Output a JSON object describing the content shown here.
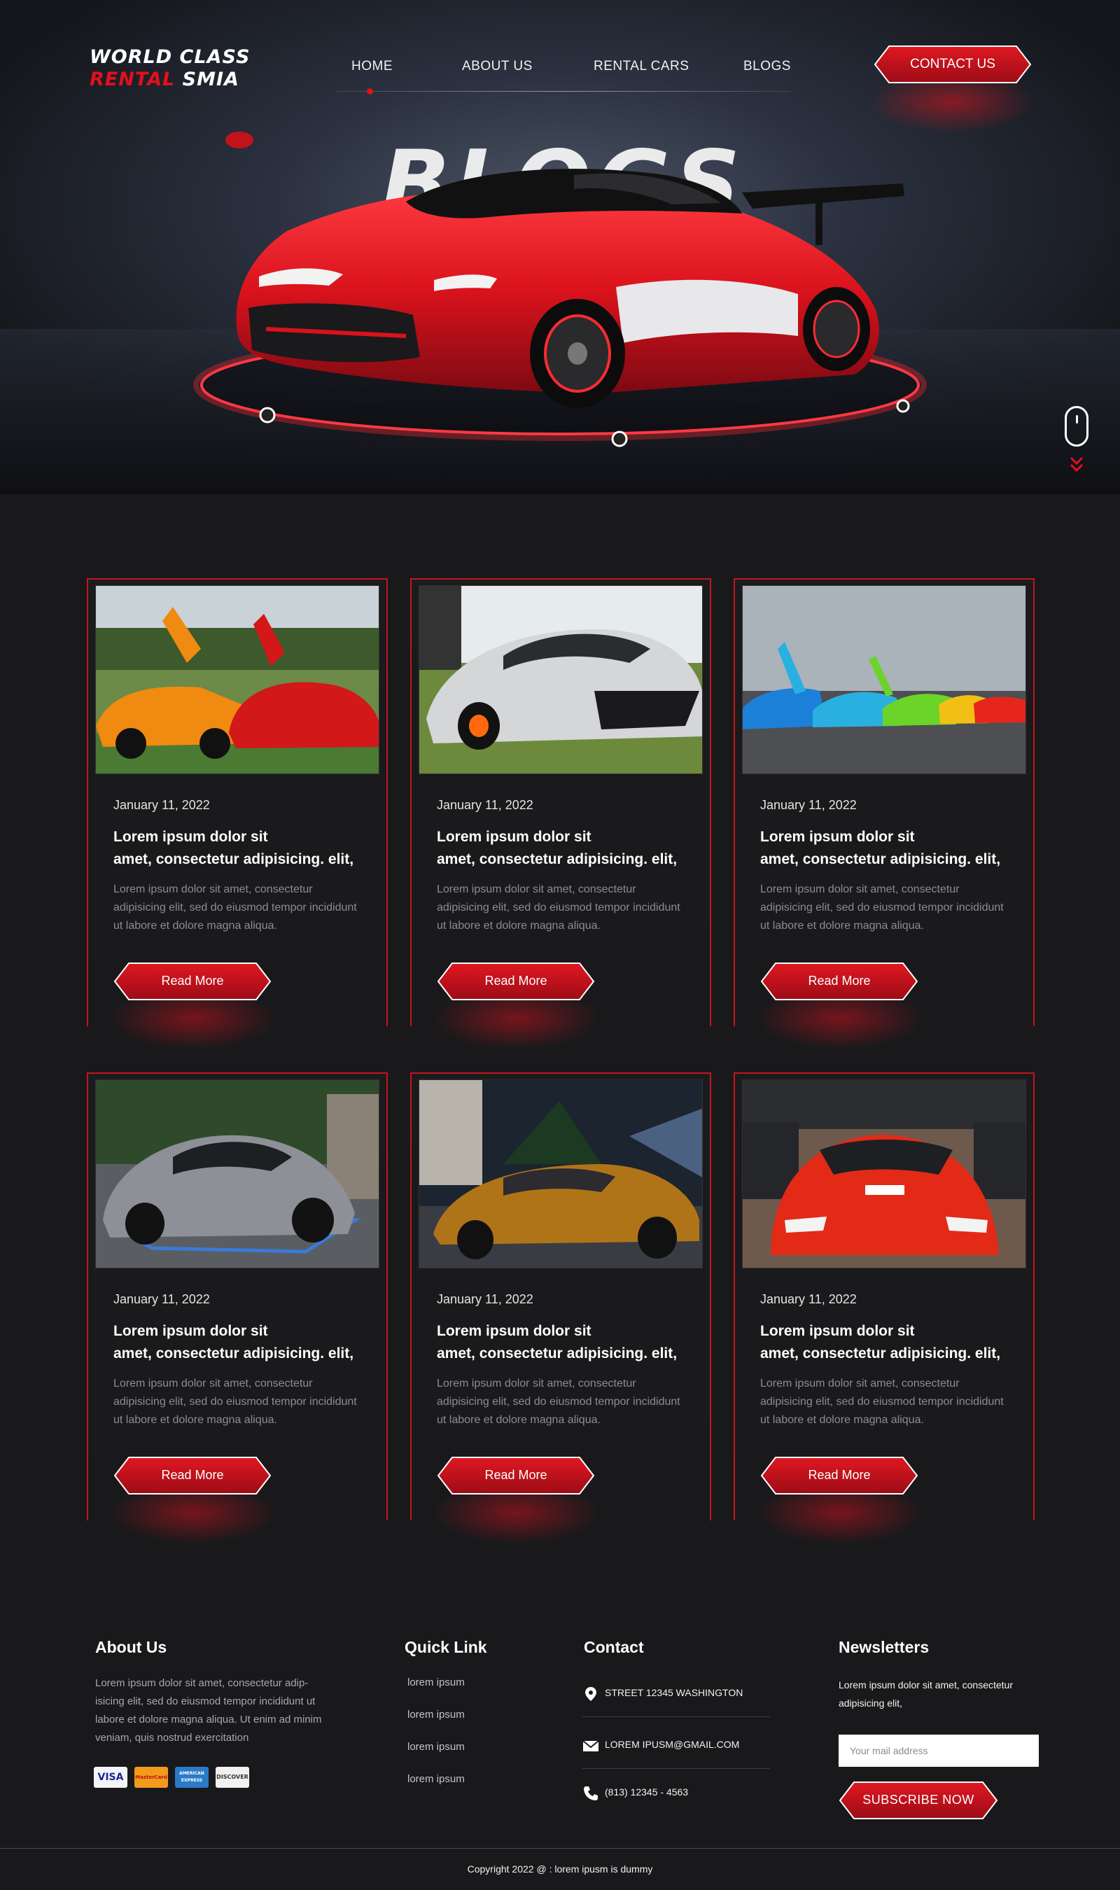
{
  "header": {
    "logo_line1": "WORLD CLASS",
    "logo_line2_red": "RENTAL",
    "logo_line2_white": "SMIA",
    "nav": [
      "HOME",
      "ABOUT US",
      "RENTAL CARS",
      "BLOGS"
    ],
    "contact_label": "CONTACT US"
  },
  "hero": {
    "title": "BLOGS"
  },
  "blog": {
    "posts": [
      {
        "date": "January 11, 2022",
        "title_line1": "Lorem ipsum dolor sit",
        "title_line2": "amet, consectetur adipisicing. elit,",
        "excerpt": "Lorem ipsum dolor sit amet, consectetur adipisicing elit, sed do eiusmod tempor incididunt ut labore et dolore magna aliqua.",
        "button": "Read More"
      },
      {
        "date": "January 11, 2022",
        "title_line1": "Lorem ipsum dolor sit",
        "title_line2": "amet, consectetur adipisicing. elit,",
        "excerpt": "Lorem ipsum dolor sit amet, consectetur adipisicing elit, sed do eiusmod tempor incididunt ut labore et dolore magna aliqua.",
        "button": "Read More"
      },
      {
        "date": "January 11, 2022",
        "title_line1": "Lorem ipsum dolor sit",
        "title_line2": "amet, consectetur adipisicing. elit,",
        "excerpt": "Lorem ipsum dolor sit amet, consectetur adipisicing elit, sed do eiusmod tempor incididunt ut labore et dolore magna aliqua.",
        "button": "Read More"
      },
      {
        "date": "January 11, 2022",
        "title_line1": "Lorem ipsum dolor sit",
        "title_line2": "amet, consectetur adipisicing. elit,",
        "excerpt": "Lorem ipsum dolor sit amet, consectetur adipisicing elit, sed do eiusmod tempor incididunt ut labore et dolore magna aliqua.",
        "button": "Read More"
      },
      {
        "date": "January 11, 2022",
        "title_line1": "Lorem ipsum dolor sit",
        "title_line2": "amet, consectetur adipisicing. elit,",
        "excerpt": "Lorem ipsum dolor sit amet, consectetur adipisicing elit, sed do eiusmod tempor incididunt ut labore et dolore magna aliqua.",
        "button": "Read More"
      },
      {
        "date": "January 11, 2022",
        "title_line1": "Lorem ipsum dolor sit",
        "title_line2": "amet, consectetur adipisicing. elit,",
        "excerpt": "Lorem ipsum dolor sit amet, consectetur adipisicing elit, sed do eiusmod tempor incididunt ut labore et dolore magna aliqua.",
        "button": "Read More"
      }
    ]
  },
  "footer": {
    "about_heading": "About Us",
    "about_text": "Lorem ipsum dolor sit amet, consectetur adip-isicing elit, sed do eiusmod tempor incididunt ut labore et dolore magna aliqua. Ut enim ad minim veniam, quis nostrud exercitation",
    "payment_cards": [
      "VISA",
      "MasterCard",
      "AMERICAN EXPRESS",
      "DISCOVER"
    ],
    "quick_heading": "Quick Link",
    "quick_links": [
      "lorem ipsum",
      "lorem ipsum",
      "lorem ipsum",
      "lorem ipsum"
    ],
    "contact_heading": "Contact",
    "contact_address": "STREET 12345 WASHINGTON",
    "contact_email": "LOREM IPUSM@GMAIL.COM",
    "contact_phone": "(813) 12345 - 4563",
    "news_heading": "Newsletters",
    "news_text": "Lorem ipsum dolor sit amet, consectetur adipisicing elit,",
    "news_placeholder": "Your mail address",
    "subscribe_label": "SUBSCRIBE NOW",
    "copyright": "Copyright 2022  @ : lorem ipusm is dummy"
  },
  "colors": {
    "accent": "#d8121e",
    "background": "#19191b",
    "card_border": "#c51420"
  }
}
